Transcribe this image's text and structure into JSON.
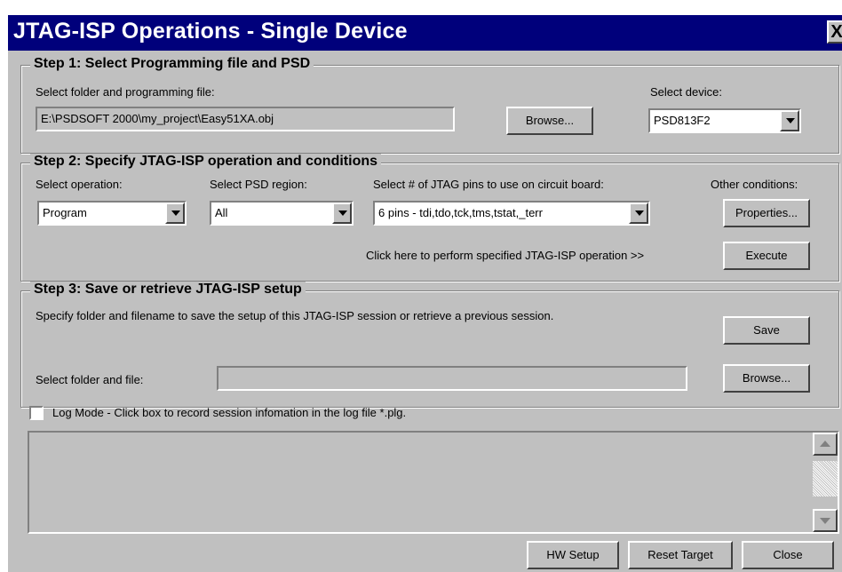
{
  "window": {
    "title": "JTAG-ISP Operations - Single Device",
    "close_label": "X"
  },
  "step1": {
    "legend": "Step 1: Select Programming file and PSD",
    "file_label": "Select folder and programming file:",
    "file_value": "E:\\PSDSOFT 2000\\my_project\\Easy51XA.obj",
    "browse_label": "Browse...",
    "device_label": "Select device:",
    "device_value": "PSD813F2"
  },
  "step2": {
    "legend": "Step 2: Specify JTAG-ISP operation and conditions",
    "operation_label": "Select operation:",
    "operation_value": "Program",
    "region_label": "Select PSD region:",
    "region_value": "All",
    "pins_label": "Select # of JTAG pins to use on circuit board:",
    "pins_value": "6 pins - tdi,tdo,tck,tms,tstat,_terr",
    "other_label": "Other conditions:",
    "properties_label": "Properties...",
    "execute_hint": "Click here to perform specified JTAG-ISP operation >>",
    "execute_label": "Execute"
  },
  "step3": {
    "legend": "Step 3: Save or retrieve JTAG-ISP setup",
    "description": "Specify folder and filename to save the setup of this JTAG-ISP session or retrieve a previous session.",
    "save_label": "Save",
    "folder_label": "Select folder and file:",
    "folder_value": "",
    "browse_label": "Browse..."
  },
  "log": {
    "checkbox_label": "Log Mode - Click box to record session infomation in the log file *.plg.",
    "checked": false
  },
  "footer": {
    "hw_setup_label": "HW Setup",
    "reset_target_label": "Reset Target",
    "close_label": "Close"
  }
}
